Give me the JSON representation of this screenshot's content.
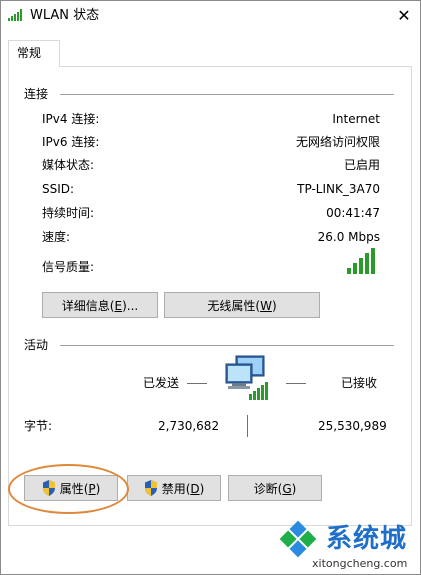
{
  "window": {
    "title": "WLAN 状态",
    "close_glyph": "✕"
  },
  "tabs": [
    {
      "label": "常规"
    }
  ],
  "connection": {
    "heading": "连接",
    "rows": [
      {
        "label": "IPv4 连接:",
        "value": "Internet"
      },
      {
        "label": "IPv6 连接:",
        "value": "无网络访问权限"
      },
      {
        "label": "媒体状态:",
        "value": "已启用"
      },
      {
        "label": "SSID:",
        "value": "TP-LINK_3A70"
      },
      {
        "label": "持续时间:",
        "value": "00:41:47"
      },
      {
        "label": "速度:",
        "value": "26.0 Mbps"
      }
    ],
    "signal_label": "信号质量:",
    "signal_bars_lit": 5,
    "signal_bars_total": 5
  },
  "buttons": {
    "details": {
      "text": "详细信息(",
      "key": "E",
      "suffix": ")..."
    },
    "wireless": {
      "text": "无线属性(",
      "key": "W",
      "suffix": ")"
    },
    "properties": {
      "text": "属性(",
      "key": "P",
      "suffix": ")"
    },
    "disable": {
      "text": "禁用(",
      "key": "D",
      "suffix": ")"
    },
    "diagnose": {
      "text": "诊断(",
      "key": "G",
      "suffix": ")"
    }
  },
  "activity": {
    "heading": "活动",
    "sent_label": "已发送",
    "received_label": "已接收",
    "bytes_label": "字节:",
    "bytes_sent": "2,730,682",
    "bytes_received": "25,530,989"
  },
  "watermark": {
    "text": "系统城",
    "url": "xitongcheng.com"
  },
  "colors": {
    "signal_green": "#2a9a2a",
    "highlight": "#e0883a",
    "watermark_blue": "#1f6fc9"
  }
}
